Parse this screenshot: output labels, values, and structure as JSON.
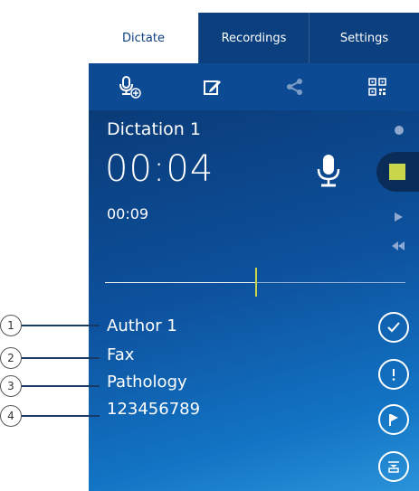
{
  "tabs": [
    {
      "label": "Dictate",
      "active": true
    },
    {
      "label": "Recordings",
      "active": false
    },
    {
      "label": "Settings",
      "active": false
    }
  ],
  "toolbar": {
    "icons": [
      "new-dictation-icon",
      "edit-icon",
      "share-icon",
      "qr-code-icon"
    ]
  },
  "dictation": {
    "title": "Dictation 1",
    "elapsed": "00:04",
    "total": "00:09",
    "position_fraction": 0.5
  },
  "properties": {
    "author": "Author 1",
    "worktype": "Fax",
    "category": "Pathology",
    "number": "123456789"
  },
  "callouts": [
    "1",
    "2",
    "3",
    "4"
  ],
  "colors": {
    "tab_bar": "#0b3f7e",
    "toolbar": "#0d4a94",
    "accent": "#c7d64b"
  }
}
